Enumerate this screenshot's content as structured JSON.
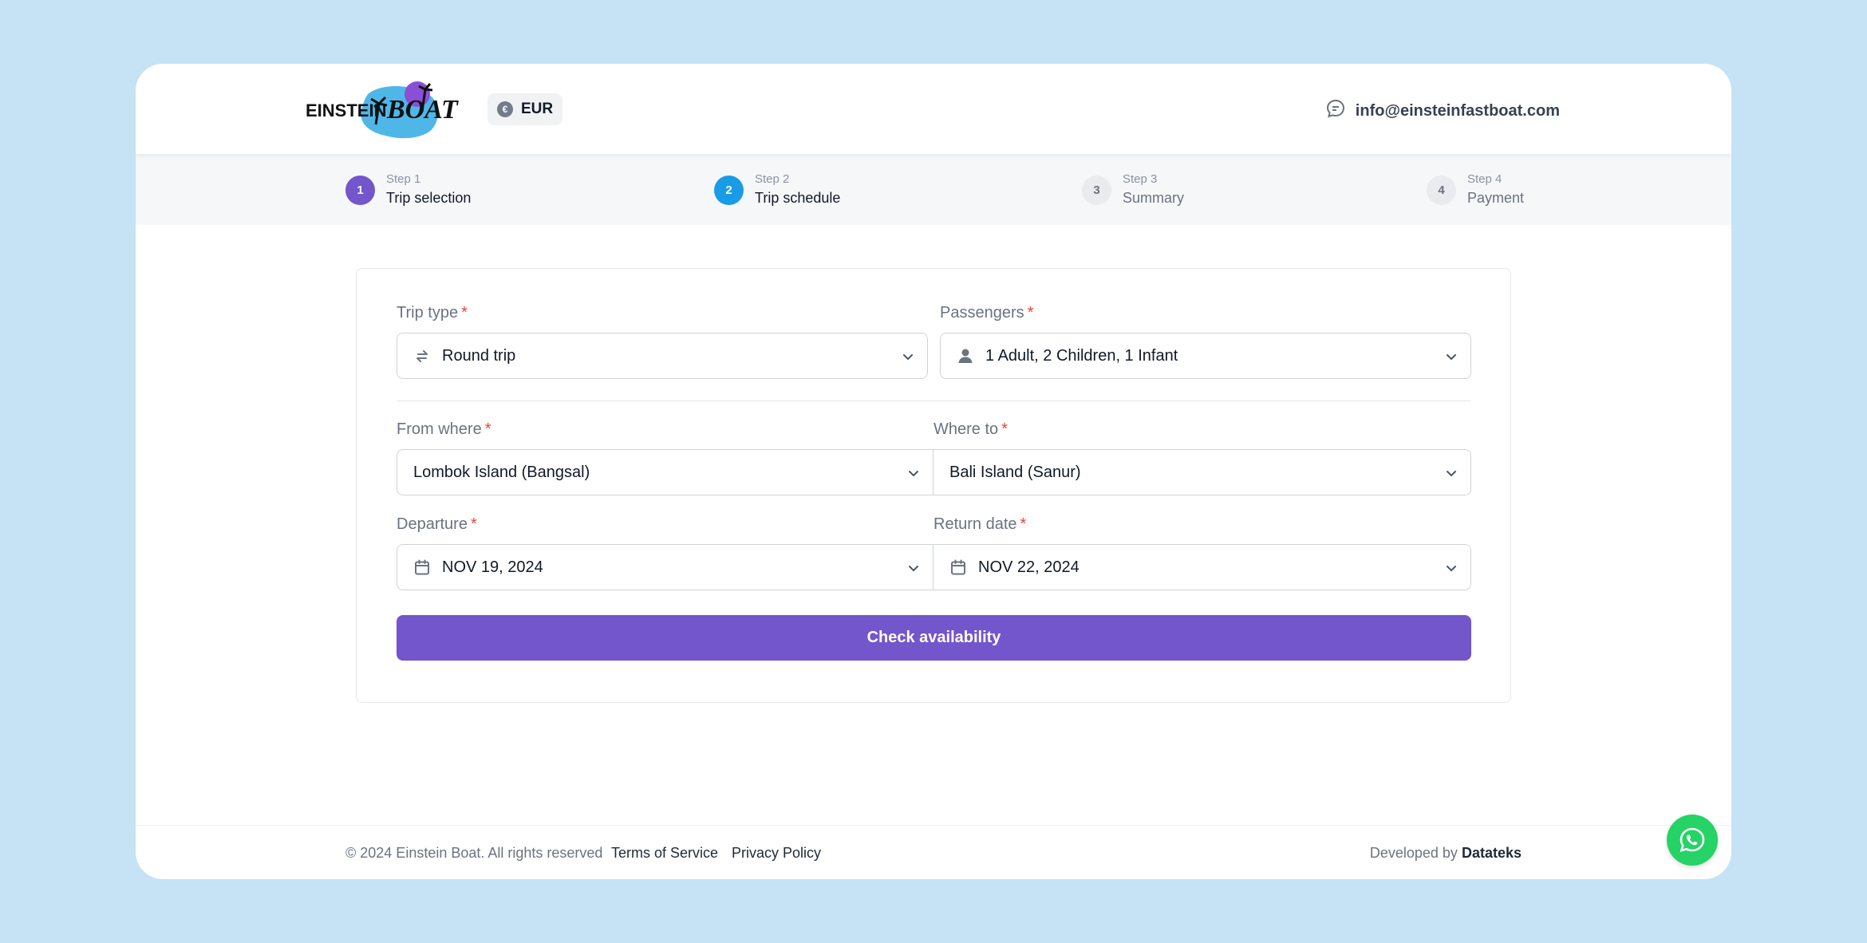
{
  "header": {
    "logo_text": "EINSTEIN BOAT",
    "currency": "EUR",
    "currency_symbol": "€",
    "contact_email": "info@einsteinfastboat.com"
  },
  "steps": [
    {
      "number": "1",
      "caption": "Step 1",
      "title": "Trip selection",
      "state": "current"
    },
    {
      "number": "2",
      "caption": "Step 2",
      "title": "Trip schedule",
      "state": "active"
    },
    {
      "number": "3",
      "caption": "Step 3",
      "title": "Summary",
      "state": "inactive"
    },
    {
      "number": "4",
      "caption": "Step 4",
      "title": "Payment",
      "state": "inactive"
    }
  ],
  "form": {
    "required_mark": "*",
    "trip_type": {
      "label": "Trip type",
      "value": "Round trip"
    },
    "passengers": {
      "label": "Passengers",
      "value": "1 Adult, 2 Children, 1 Infant"
    },
    "from": {
      "label": "From where",
      "value": "Lombok Island (Bangsal)"
    },
    "to": {
      "label": "Where to",
      "value": "Bali Island (Sanur)"
    },
    "departure": {
      "label": "Departure",
      "value": "NOV 19, 2024"
    },
    "return_date": {
      "label": "Return date",
      "value": "NOV 22, 2024"
    },
    "submit_label": "Check availability"
  },
  "footer": {
    "copyright": "© 2024 Einstein Boat. All rights reserved",
    "terms": "Terms of Service",
    "privacy": "Privacy Policy",
    "developed_by": "Developed by",
    "developer": "Datateks"
  },
  "colors": {
    "page_bg": "#c5e3f4",
    "primary": "#7355cc",
    "step2": "#1a9be6",
    "whatsapp": "#25d366",
    "required": "#ea4335"
  }
}
